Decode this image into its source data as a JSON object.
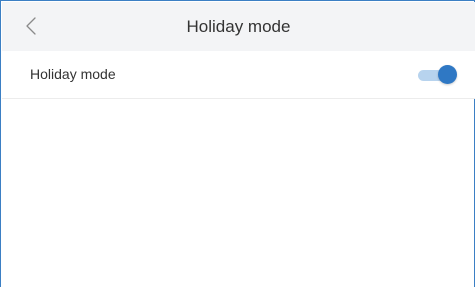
{
  "header": {
    "back_icon": "chevron-left-icon",
    "title": "Holiday mode"
  },
  "settings": {
    "rows": [
      {
        "label": "Holiday mode",
        "control": "toggle",
        "enabled": true
      }
    ]
  },
  "colors": {
    "accent": "#2f78c4",
    "toggle_track_on": "#b7d3ee",
    "header_bg": "#f3f4f6",
    "frame_border": "#3b7fc4"
  }
}
